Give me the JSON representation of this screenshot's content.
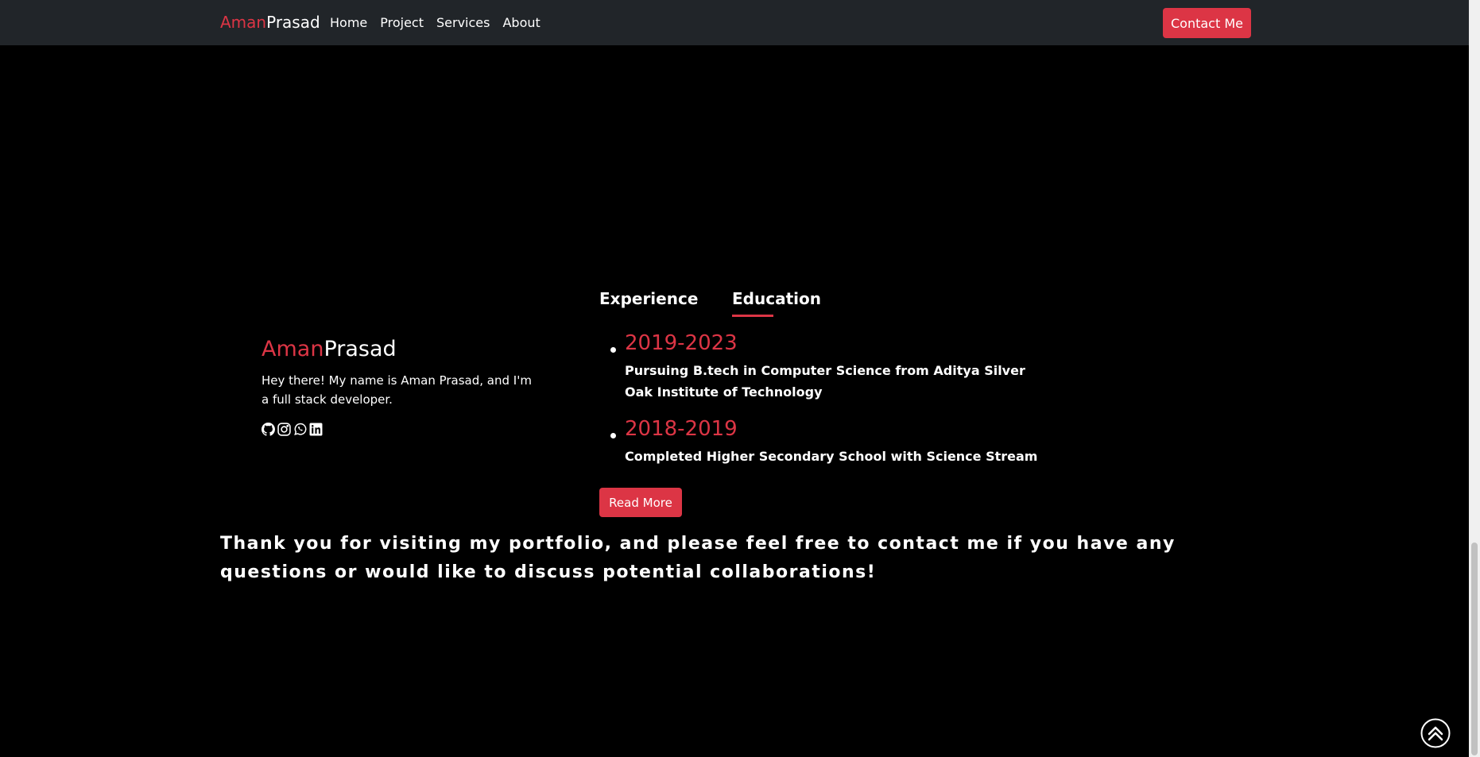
{
  "navbar": {
    "brand_first": "Aman",
    "brand_second": "Prasad",
    "links": [
      "Home",
      "Project",
      "Services",
      "About"
    ],
    "contact_label": "Contact Me"
  },
  "profile": {
    "name_first": "Aman",
    "name_second": "Prasad",
    "bio": "Hey there! My name is Aman Prasad, and I'm a full stack developer.",
    "socials": [
      "github-icon",
      "instagram-icon",
      "whatsapp-icon",
      "linkedin-icon"
    ]
  },
  "tabs": {
    "experience": "Experience",
    "education": "Education",
    "active": "Education"
  },
  "education": [
    {
      "year": "2019-2023",
      "description": "Pursuing B.tech in Computer Science from Aditya Silver Oak Institute of Technology"
    },
    {
      "year": "2018-2019",
      "description": "Completed Higher Secondary School with Science Stream"
    }
  ],
  "read_more_label": "Read More",
  "thanks_message": "Thank you for visiting my portfolio, and please feel free to contact me if you have any questions or would like to discuss potential collaborations!",
  "colors": {
    "accent": "#dc3545",
    "navbar_bg": "#212529",
    "page_bg": "#000000"
  }
}
